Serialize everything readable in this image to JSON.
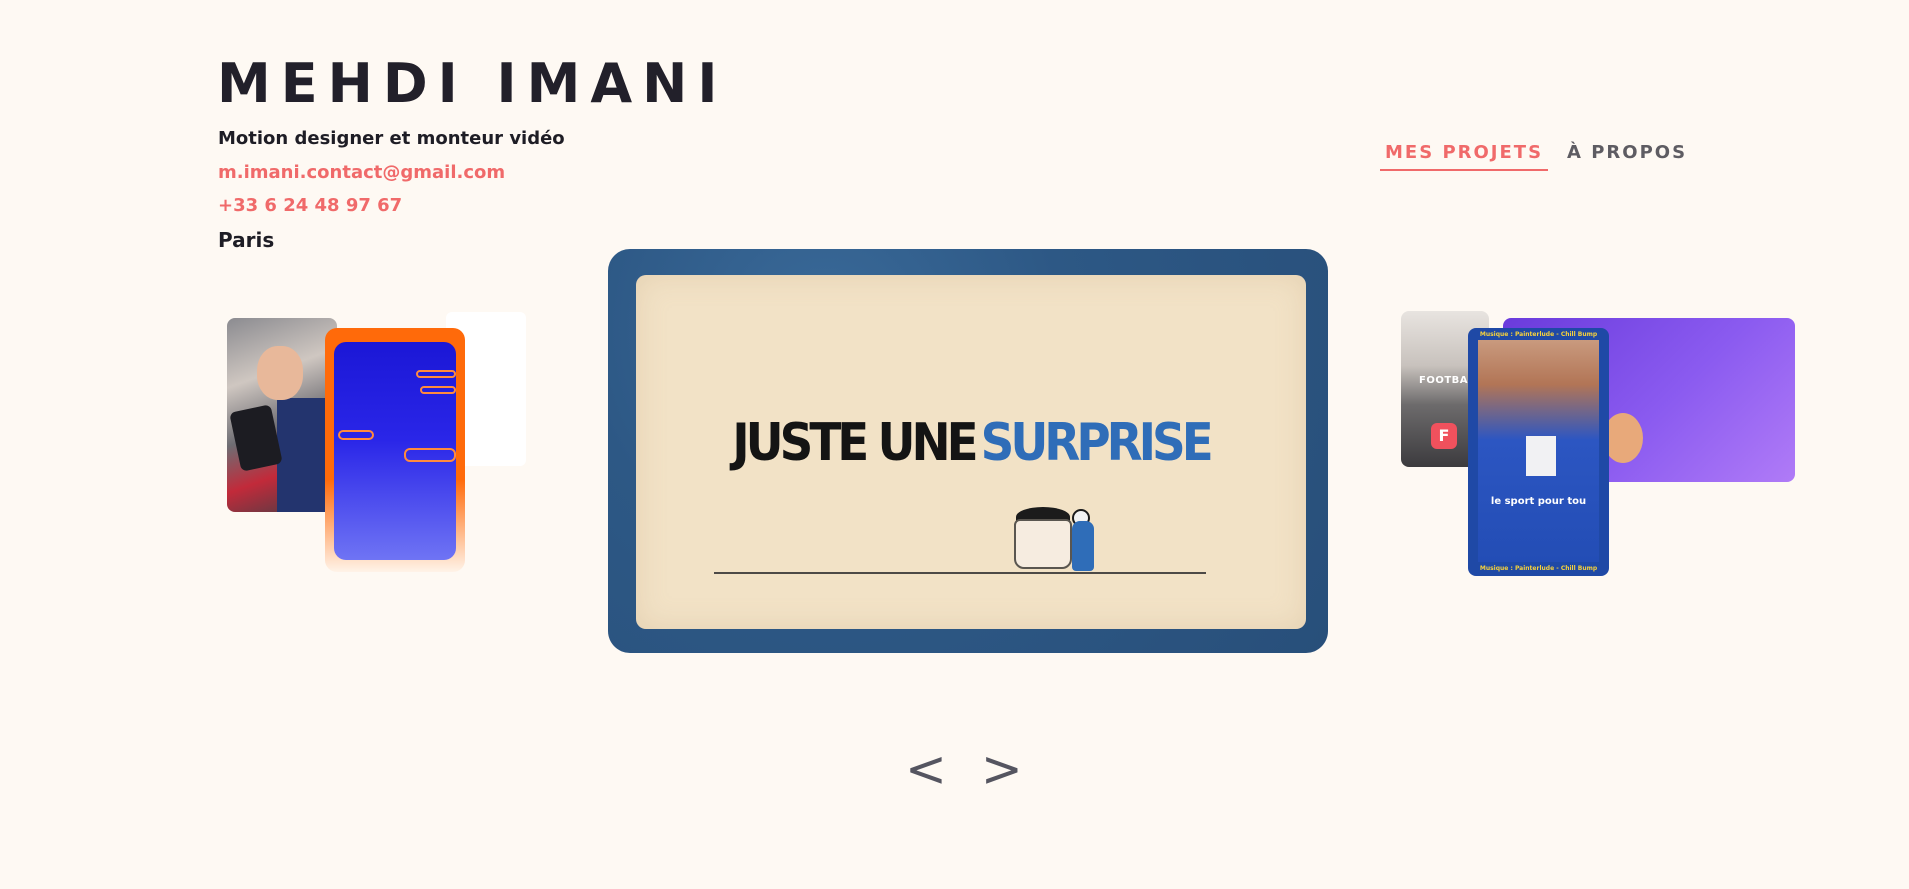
{
  "header": {
    "name": "MEHDI IMANI",
    "tagline": "Motion designer et monteur vidéo",
    "email": "m.imani.contact@gmail.com",
    "phone": "+33 6 24 48 97 67",
    "city": "Paris"
  },
  "nav": {
    "items": [
      {
        "label": "MES PROJETS",
        "active": true
      },
      {
        "label": "À PROPOS",
        "active": false
      }
    ]
  },
  "featured": {
    "title_part1": "JUSTE UNE",
    "title_part2": "SURPRISE"
  },
  "thumbnails_right": {
    "football_label": "FOOTBAR",
    "judo_top_text": "Musique : Painterlude - Chill Bump",
    "judo_caption": "le sport pour tou",
    "judo_bottom_text": "Musique : Painterlude - Chill Bump"
  },
  "carousel": {
    "prev": "<",
    "next": ">"
  },
  "colors": {
    "background": "#fef9f3",
    "accent": "#f06a6a",
    "text": "#1e1d25"
  }
}
